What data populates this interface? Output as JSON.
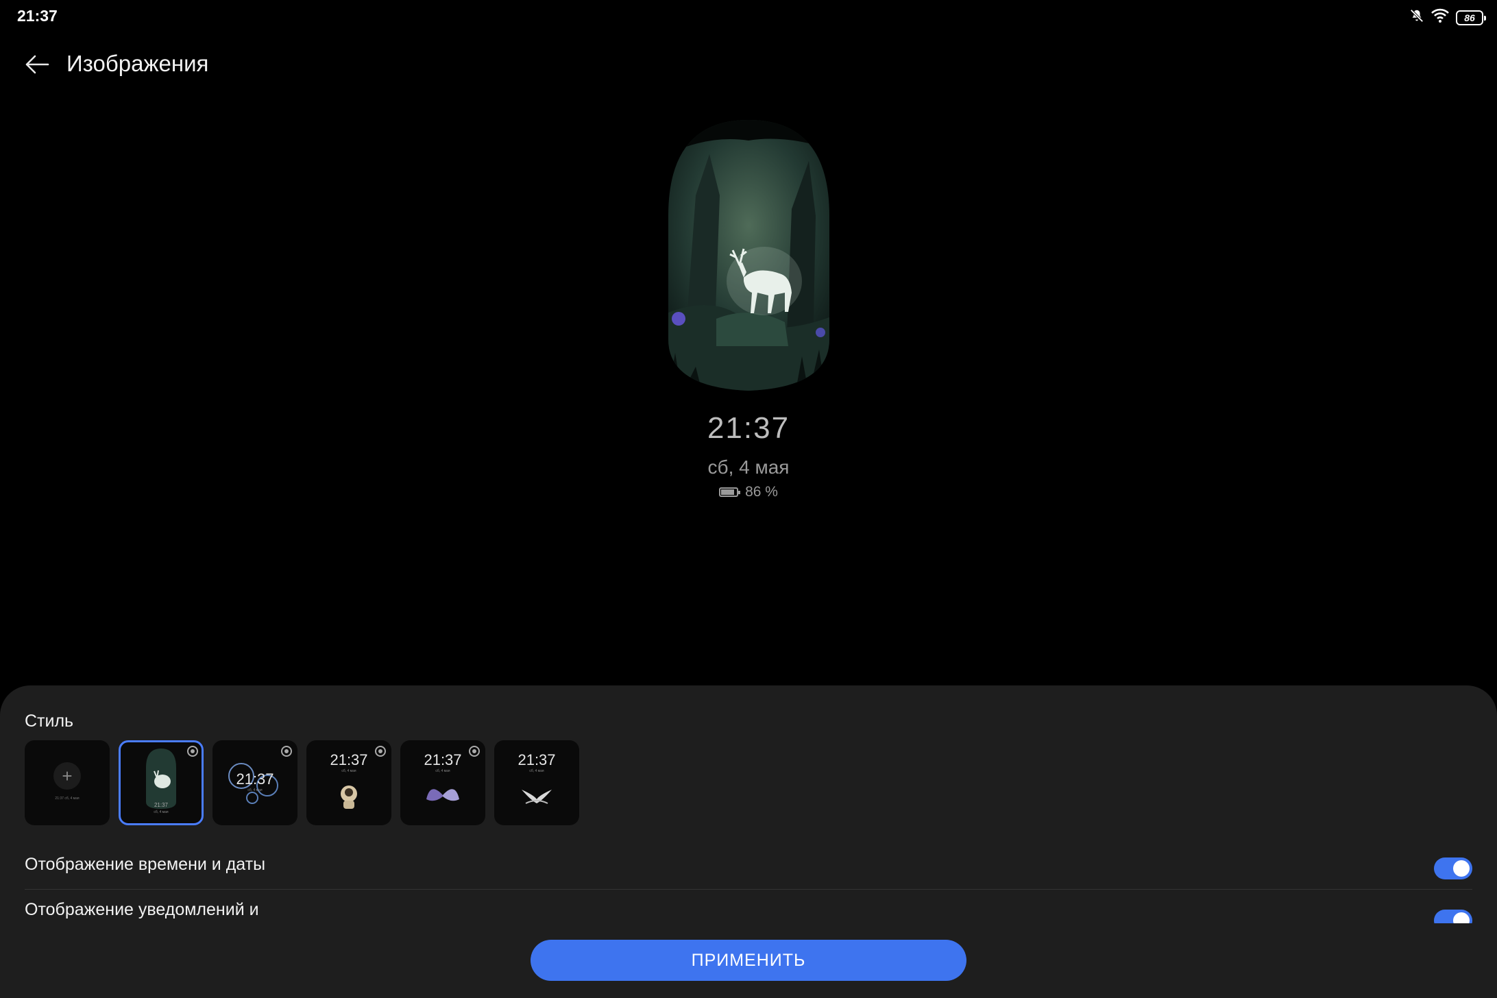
{
  "status_bar": {
    "time": "21:37",
    "battery_level": "86",
    "icons": [
      "bell-off-icon",
      "wifi-icon",
      "battery-icon"
    ]
  },
  "header": {
    "title": "Изображения",
    "back_icon": "arrow-left-icon"
  },
  "preview": {
    "time": "21:37",
    "date": "сб, 4 мая",
    "battery": "86 %",
    "artwork": "deer-forest"
  },
  "style_section": {
    "label": "Стиль",
    "thumbnails": [
      {
        "id": "add",
        "icon": "plus-icon",
        "sub": "21:37 сб, 4 мая"
      },
      {
        "id": "deer",
        "selected": true,
        "time": "21:37",
        "sub": "сб, 4 мая"
      },
      {
        "id": "bubbles",
        "time": "21:37",
        "sub": "сб, 4 мая"
      },
      {
        "id": "astronaut",
        "time": "21:37",
        "sub": "сб, 4 мая"
      },
      {
        "id": "butterfly",
        "time": "21:37",
        "sub": "сб, 4 мая"
      },
      {
        "id": "bird",
        "time": "21:37",
        "sub": "сб, 4 мая"
      }
    ]
  },
  "settings": [
    {
      "label": "Отображение времени и даты",
      "enabled": true
    },
    {
      "label": "Отображение уведомлений и",
      "enabled": true
    }
  ],
  "apply_button": {
    "label": "ПРИМЕНИТЬ"
  },
  "colors": {
    "accent": "#3e74ef",
    "sheet": "#1e1e1e",
    "background": "#000000"
  }
}
